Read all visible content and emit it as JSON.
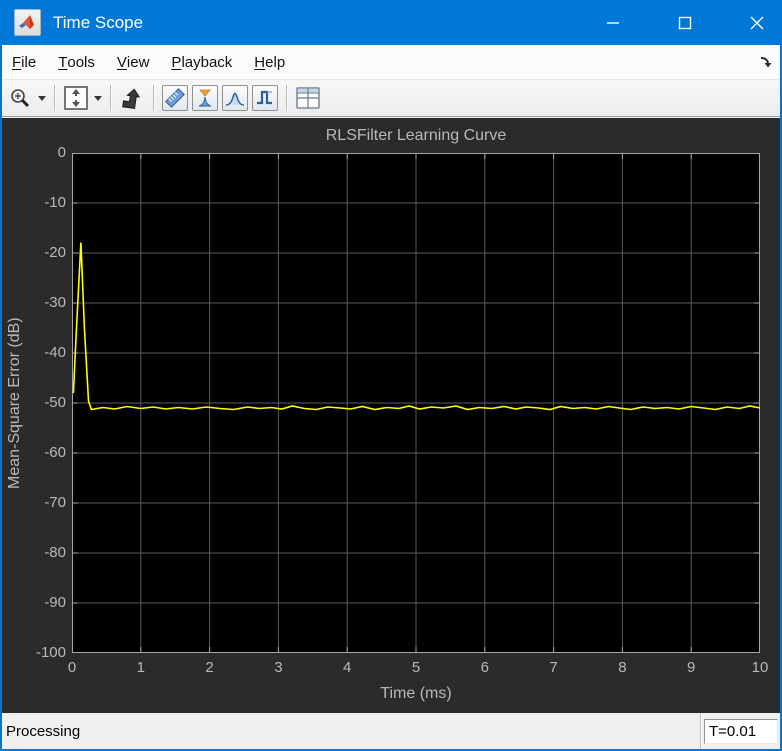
{
  "window": {
    "title": "Time Scope"
  },
  "menu": {
    "items": [
      {
        "id": "file",
        "label": "File"
      },
      {
        "id": "tools",
        "label": "Tools"
      },
      {
        "id": "view",
        "label": "View"
      },
      {
        "id": "playback",
        "label": "Playback"
      },
      {
        "id": "help",
        "label": "Help"
      }
    ]
  },
  "toolbar": {
    "icons": [
      "zoom-in-icon",
      "zoom-dropdown-arrow-icon",
      "autoscale-icon",
      "autoscale-dropdown-arrow-icon",
      "step-forward-icon",
      "cursor-measurements-ruler-icon",
      "signal-statistics-icon",
      "peak-finder-icon",
      "bilevel-measurements-icon",
      "layout-grid-icon"
    ]
  },
  "colors": {
    "titlebar": "#0078d7",
    "figure_bg": "#2b2b2b",
    "axes_bg": "#000000",
    "grid": "#5c5c5c",
    "axes_border": "#a6a6a6",
    "tick_text": "#b8b8b8",
    "line": "#ffff00",
    "status_bg": "#f0f0f0"
  },
  "chart_data": {
    "type": "line",
    "title": "RLSFilter Learning Curve",
    "xlabel": "Time (ms)",
    "ylabel": "Mean-Square Error (dB)",
    "xlim": [
      0,
      10
    ],
    "ylim": [
      -100,
      0
    ],
    "xticks": [
      0,
      1,
      2,
      3,
      4,
      5,
      6,
      7,
      8,
      9,
      10
    ],
    "yticks": [
      0,
      -10,
      -20,
      -30,
      -40,
      -50,
      -60,
      -70,
      -80,
      -90,
      -100
    ],
    "grid": true,
    "legend": "none",
    "line_color": "#ffff00",
    "series": [
      {
        "name": "MSE",
        "points": [
          [
            0.02,
            -48.0
          ],
          [
            0.06,
            -36.5
          ],
          [
            0.13,
            -17.9
          ],
          [
            0.18,
            -35.0
          ],
          [
            0.24,
            -49.6
          ],
          [
            0.28,
            -51.3
          ],
          [
            0.45,
            -50.9
          ],
          [
            0.62,
            -51.2
          ],
          [
            0.8,
            -50.7
          ],
          [
            1.0,
            -51.1
          ],
          [
            1.18,
            -50.8
          ],
          [
            1.36,
            -51.2
          ],
          [
            1.55,
            -50.9
          ],
          [
            1.75,
            -51.2
          ],
          [
            1.95,
            -50.8
          ],
          [
            2.15,
            -51.1
          ],
          [
            2.35,
            -51.3
          ],
          [
            2.55,
            -50.8
          ],
          [
            2.72,
            -51.1
          ],
          [
            2.9,
            -50.9
          ],
          [
            3.05,
            -51.2
          ],
          [
            3.2,
            -50.6
          ],
          [
            3.38,
            -51.1
          ],
          [
            3.55,
            -51.3
          ],
          [
            3.72,
            -50.8
          ],
          [
            3.9,
            -51.0
          ],
          [
            4.05,
            -51.2
          ],
          [
            4.22,
            -50.7
          ],
          [
            4.4,
            -51.3
          ],
          [
            4.58,
            -50.9
          ],
          [
            4.75,
            -51.1
          ],
          [
            4.9,
            -50.6
          ],
          [
            5.05,
            -51.2
          ],
          [
            5.22,
            -50.8
          ],
          [
            5.4,
            -51.0
          ],
          [
            5.58,
            -50.6
          ],
          [
            5.75,
            -51.3
          ],
          [
            5.92,
            -50.9
          ],
          [
            6.1,
            -51.1
          ],
          [
            6.28,
            -50.7
          ],
          [
            6.45,
            -51.2
          ],
          [
            6.6,
            -50.8
          ],
          [
            6.78,
            -51.0
          ],
          [
            6.95,
            -51.3
          ],
          [
            7.1,
            -50.7
          ],
          [
            7.28,
            -51.1
          ],
          [
            7.45,
            -50.9
          ],
          [
            7.62,
            -51.2
          ],
          [
            7.8,
            -50.7
          ],
          [
            7.95,
            -51.0
          ],
          [
            8.12,
            -51.3
          ],
          [
            8.3,
            -50.8
          ],
          [
            8.48,
            -51.1
          ],
          [
            8.65,
            -50.9
          ],
          [
            8.82,
            -51.2
          ],
          [
            9.0,
            -50.7
          ],
          [
            9.18,
            -51.0
          ],
          [
            9.35,
            -51.3
          ],
          [
            9.52,
            -50.8
          ],
          [
            9.7,
            -51.1
          ],
          [
            9.85,
            -50.6
          ],
          [
            10.0,
            -51.0
          ]
        ]
      }
    ]
  },
  "status": {
    "left": "Processing",
    "right": "T=0.01"
  }
}
